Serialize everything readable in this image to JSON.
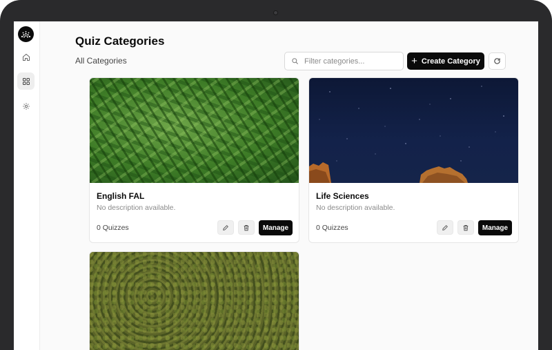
{
  "app": {
    "page_title": "Quiz Categories",
    "subtitle": "All Categories"
  },
  "sidebar": {
    "items": [
      {
        "name": "home",
        "icon": "home-icon"
      },
      {
        "name": "categories",
        "icon": "grid-icon",
        "active": true
      },
      {
        "name": "settings",
        "icon": "gear-icon"
      }
    ]
  },
  "toolbar": {
    "search_placeholder": "Filter categories...",
    "create_label": "Create Category",
    "refresh_icon": "refresh-icon"
  },
  "categories": [
    {
      "title": "English FAL",
      "description": "No description available.",
      "count": "0 Quizzes",
      "manage_label": "Manage",
      "image": "green-beans"
    },
    {
      "title": "Life Sciences",
      "description": "No description available.",
      "count": "0 Quizzes",
      "manage_label": "Manage",
      "image": "night-sky-rocks"
    },
    {
      "image": "forest-aerial"
    }
  ],
  "colors": {
    "primary": "#0a0a0a",
    "background": "#fafafa",
    "muted_text": "#8a8a8a"
  }
}
